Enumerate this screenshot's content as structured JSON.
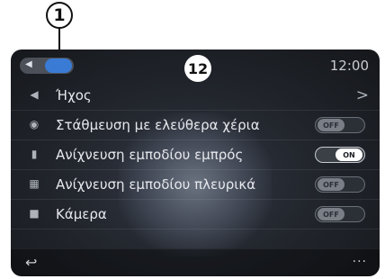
{
  "callout": {
    "number": "1"
  },
  "header": {
    "badge": "12",
    "clock": "12:00"
  },
  "rows": [
    {
      "icon": "speaker-icon",
      "label": "Ήχος",
      "control": "chevron",
      "chevron": ">"
    },
    {
      "icon": "parking-icon",
      "label": "Στάθμευση με ελεύθερα χέρια",
      "control": "toggle",
      "toggle": "OFF"
    },
    {
      "icon": "front-sensor-icon",
      "label": "Ανίχνευση εμποδίου εμπρός",
      "control": "toggle",
      "toggle": "ON"
    },
    {
      "icon": "side-sensor-icon",
      "label": "Ανίχνευση εμποδίου πλευρικά",
      "control": "toggle",
      "toggle": "OFF"
    },
    {
      "icon": "camera-icon",
      "label": "Κάμερα",
      "control": "toggle",
      "toggle": "OFF"
    }
  ],
  "footer": {
    "back": "↩",
    "more": "···"
  },
  "colors": {
    "accent": "#3a7bd5",
    "background": "#1c1f24"
  }
}
